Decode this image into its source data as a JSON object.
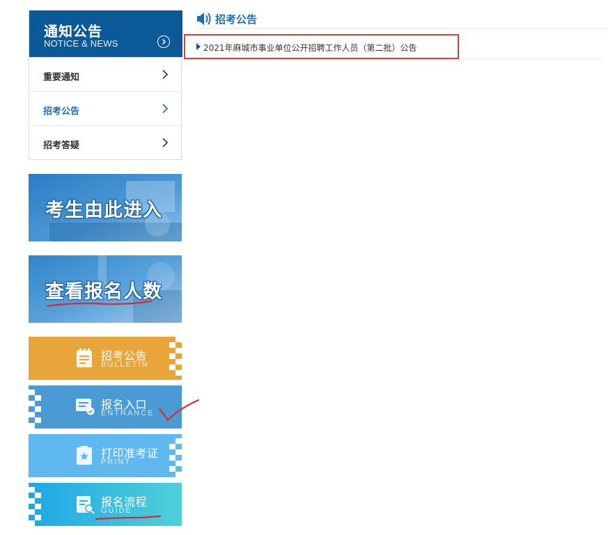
{
  "sidebar": {
    "notice": {
      "title": "通知公告",
      "subtitle": "NOTICE & NEWS"
    },
    "menu": [
      {
        "label": "重要通知",
        "active": false
      },
      {
        "label": "招考公告",
        "active": true
      },
      {
        "label": "招考答疑",
        "active": false
      }
    ],
    "banners": [
      {
        "label": "考生由此进入"
      },
      {
        "label": "查看报名人数"
      }
    ],
    "tiles": [
      {
        "title": "招考公告",
        "subtitle": "BULLETIN",
        "icon": "bulletin-icon",
        "color": "#e8a53a"
      },
      {
        "title": "报名入口",
        "subtitle": "ENTRANCE",
        "icon": "entrance-icon",
        "color": "#4a9ad3"
      },
      {
        "title": "打印准考证",
        "subtitle": "PRINT",
        "icon": "print-icon",
        "color": "#5fb9ef"
      },
      {
        "title": "报名流程",
        "subtitle": "GUIDE",
        "icon": "guide-icon",
        "color": "#36c6d8"
      }
    ]
  },
  "main": {
    "section_title": "招考公告",
    "section_icon": "speaker-icon",
    "news": [
      {
        "title": "2021年麻城市事业单位公开招聘工作人员（第二批）公告"
      }
    ]
  },
  "colors": {
    "primary": "#0b5a97",
    "link": "#1f6cb5",
    "highlight": "#e23a3a"
  }
}
